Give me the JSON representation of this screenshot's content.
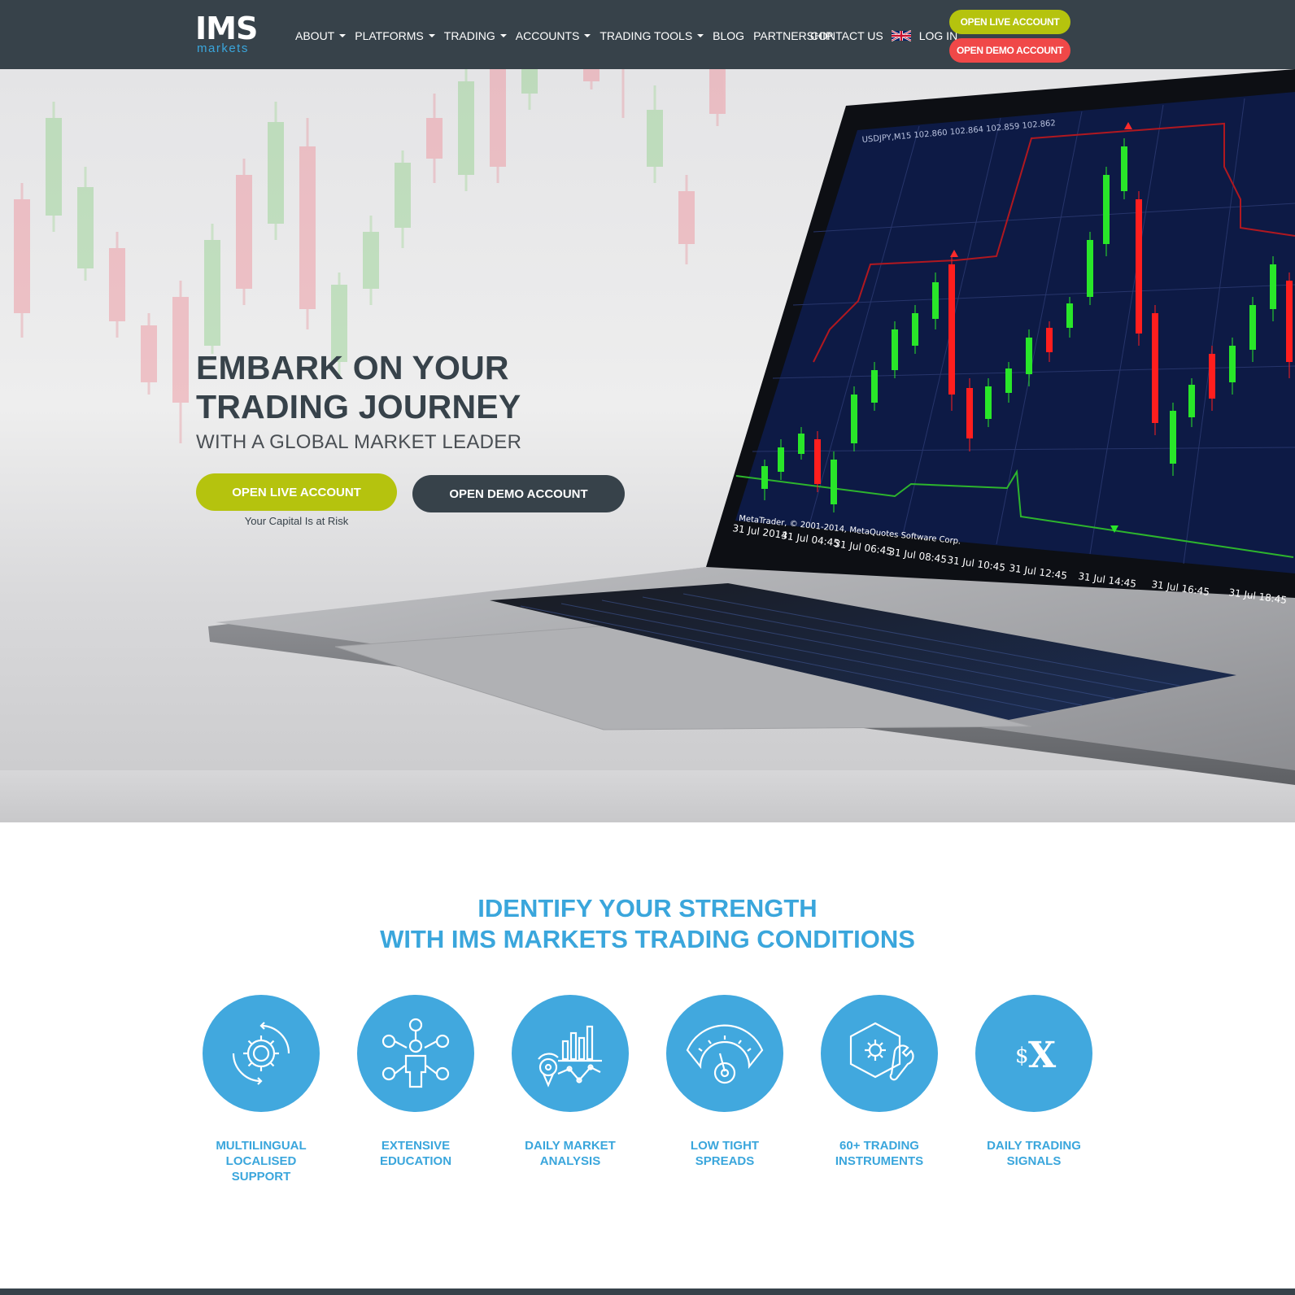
{
  "brand": {
    "logo_main": "IMS",
    "logo_sub": "markets"
  },
  "nav": {
    "items": [
      {
        "label": "ABOUT",
        "dropdown": true
      },
      {
        "label": "PLATFORMS",
        "dropdown": true
      },
      {
        "label": "TRADING",
        "dropdown": true
      },
      {
        "label": "ACCOUNTS",
        "dropdown": true
      },
      {
        "label": "TRADING TOOLS",
        "dropdown": true
      },
      {
        "label": "BLOG",
        "dropdown": false
      },
      {
        "label": "PARTNERSHIP",
        "dropdown": false
      }
    ],
    "contact_label": "CONTACT US",
    "language_icon": "uk-flag-icon",
    "login_label": "LOG IN",
    "open_live_label": "OPEN LIVE ACCOUNT",
    "open_demo_label": "OPEN DEMO ACCOUNT"
  },
  "hero": {
    "title_line1": "EMBARK ON YOUR",
    "title_line2": "TRADING JOURNEY",
    "subtitle": "WITH A GLOBAL MARKET LEADER",
    "open_live_label": "OPEN LIVE ACCOUNT",
    "open_demo_label": "OPEN DEMO ACCOUNT",
    "risk_note": "Your Capital Is at Risk",
    "screen_header": "USDJPY,M15  102.860 102.864 102.859 102.862",
    "screen_footer": "MetaTrader, © 2001-2014, MetaQuotes Software Corp.",
    "screen_time_labels": [
      "31 Jul 2014",
      "31 Jul 04:45",
      "31 Jul 06:45",
      "31 Jul 08:45",
      "31 Jul 10:45",
      "31 Jul 12:45",
      "31 Jul 14:45",
      "31 Jul 16:45",
      "31 Jul 18:45"
    ]
  },
  "features": {
    "title_line1": "IDENTIFY YOUR STRENGTH",
    "title_line2": "WITH IMS MARKETS TRADING CONDITIONS",
    "items": [
      {
        "icon": "gear-cycle-icon",
        "line1": "MULTILINGUAL",
        "line2": "LOCALISED",
        "line3": "SUPPORT"
      },
      {
        "icon": "network-person-icon",
        "line1": "EXTENSIVE",
        "line2": "EDUCATION",
        "line3": ""
      },
      {
        "icon": "market-analysis-icon",
        "line1": "DAILY MARKET",
        "line2": "ANALYSIS",
        "line3": ""
      },
      {
        "icon": "gauge-icon",
        "line1": "LOW TIGHT",
        "line2": "SPREADS",
        "line3": ""
      },
      {
        "icon": "hexagon-tools-icon",
        "line1": "60+ TRADING",
        "line2": "INSTRUMENTS",
        "line3": ""
      },
      {
        "icon": "currency-signals-icon",
        "line1": "DAILY TRADING",
        "line2": "SIGNALS",
        "line3": ""
      }
    ],
    "signals_icon_text_small": "$",
    "signals_icon_text_big": "X"
  },
  "colors": {
    "nav_bg": "#37424a",
    "lime": "#b5c30e",
    "red": "#f04848",
    "accent_blue": "#3aa6dc",
    "circle_blue": "#41a8de"
  }
}
